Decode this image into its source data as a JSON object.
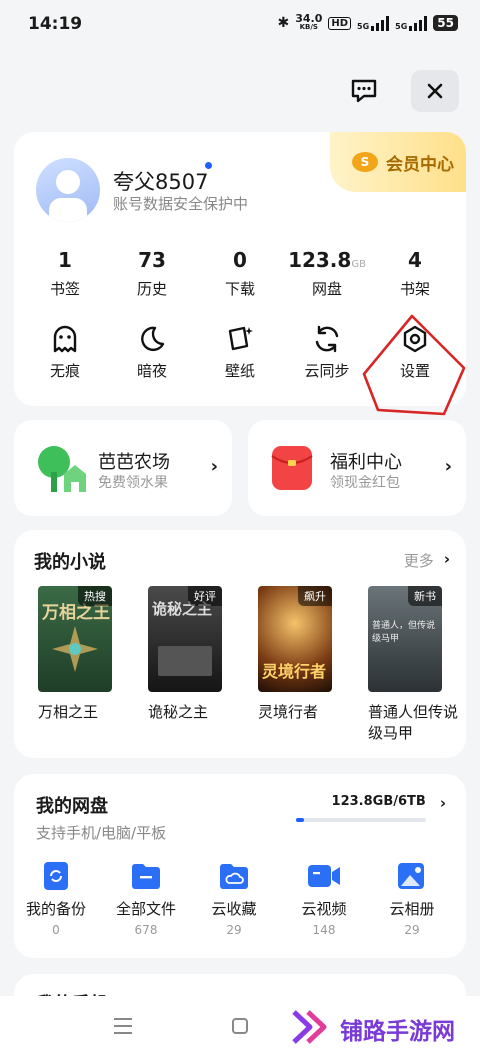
{
  "status": {
    "time": "14:19",
    "speed_top": "34.0",
    "speed_unit": "KB/S",
    "hd": "HD",
    "sim1": "5G",
    "sim2": "5G",
    "battery": "55"
  },
  "header": {
    "message_icon": "message-icon",
    "close_icon": "close-icon"
  },
  "profile": {
    "name": "夸父8507",
    "subtitle": "账号数据安全保护中",
    "vip_label": "会员中心"
  },
  "stats": [
    {
      "value": "1",
      "unit": "",
      "label": "书签"
    },
    {
      "value": "73",
      "unit": "",
      "label": "历史"
    },
    {
      "value": "0",
      "unit": "",
      "label": "下载"
    },
    {
      "value": "123.8",
      "unit": "GB",
      "label": "网盘"
    },
    {
      "value": "4",
      "unit": "",
      "label": "书架"
    }
  ],
  "tools": [
    {
      "label": "无痕",
      "icon": "ghost-icon"
    },
    {
      "label": "暗夜",
      "icon": "moon-icon"
    },
    {
      "label": "壁纸",
      "icon": "wallpaper-icon"
    },
    {
      "label": "云同步",
      "icon": "sync-icon"
    },
    {
      "label": "设置",
      "icon": "settings-icon"
    }
  ],
  "promos": [
    {
      "title": "芭芭农场",
      "subtitle": "免费领水果"
    },
    {
      "title": "福利中心",
      "subtitle": "领现金红包"
    }
  ],
  "novels": {
    "title": "我的小说",
    "more": "更多",
    "books": [
      {
        "title": "万相之王",
        "tag": "热搜",
        "cover_text": "万相之王",
        "color": "#2f5a3a"
      },
      {
        "title": "诡秘之主",
        "tag": "好评",
        "cover_text": "诡秘之主",
        "color": "#2a2a2a"
      },
      {
        "title": "灵境行者",
        "tag": "飙升",
        "cover_text": "灵境行者",
        "color": "#3b1f10"
      },
      {
        "title": "普通人但传说级马甲",
        "tag": "新书",
        "cover_text": "普通人，但传说级马甲",
        "color": "#3d4448"
      }
    ]
  },
  "disk": {
    "title": "我的网盘",
    "subtitle": "支持手机/电脑/平板",
    "usage": "123.8GB/6TB",
    "usage_fraction": 0.02,
    "items": [
      {
        "label": "我的备份",
        "count": "0",
        "icon": "backup-icon"
      },
      {
        "label": "全部文件",
        "count": "678",
        "icon": "folder-icon"
      },
      {
        "label": "云收藏",
        "count": "29",
        "icon": "cloud-collect-icon"
      },
      {
        "label": "云视频",
        "count": "148",
        "icon": "video-icon"
      },
      {
        "label": "云相册",
        "count": "29",
        "icon": "photo-icon"
      }
    ]
  },
  "next_section": {
    "title": "我的手机"
  },
  "watermark": {
    "text": "铺路手游网"
  }
}
